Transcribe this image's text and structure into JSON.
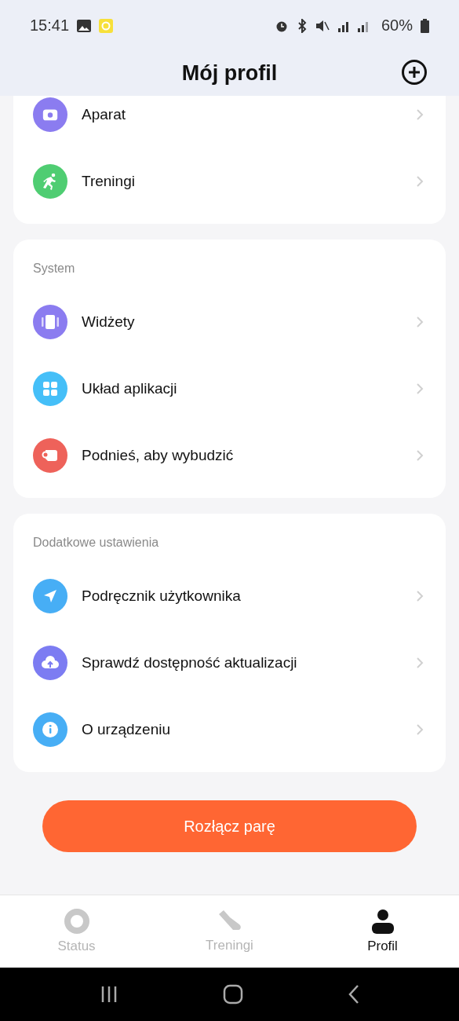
{
  "status_bar": {
    "time": "15:41",
    "battery": "60%"
  },
  "header": {
    "title": "Mój profil"
  },
  "sections": [
    {
      "items": [
        {
          "label": "Aparat"
        },
        {
          "label": "Treningi"
        }
      ]
    },
    {
      "title": "System",
      "items": [
        {
          "label": "Widżety"
        },
        {
          "label": "Układ aplikacji"
        },
        {
          "label": "Podnieś, aby wybudzić"
        }
      ]
    },
    {
      "title": "Dodatkowe ustawienia",
      "items": [
        {
          "label": "Podręcznik użytkownika"
        },
        {
          "label": "Sprawdź dostępność aktualizacji"
        },
        {
          "label": "O urządzeniu"
        }
      ]
    }
  ],
  "unpair_button": "Rozłącz parę",
  "tabs": [
    {
      "label": "Status",
      "selected": false
    },
    {
      "label": "Treningi",
      "selected": false
    },
    {
      "label": "Profil",
      "selected": true
    }
  ]
}
